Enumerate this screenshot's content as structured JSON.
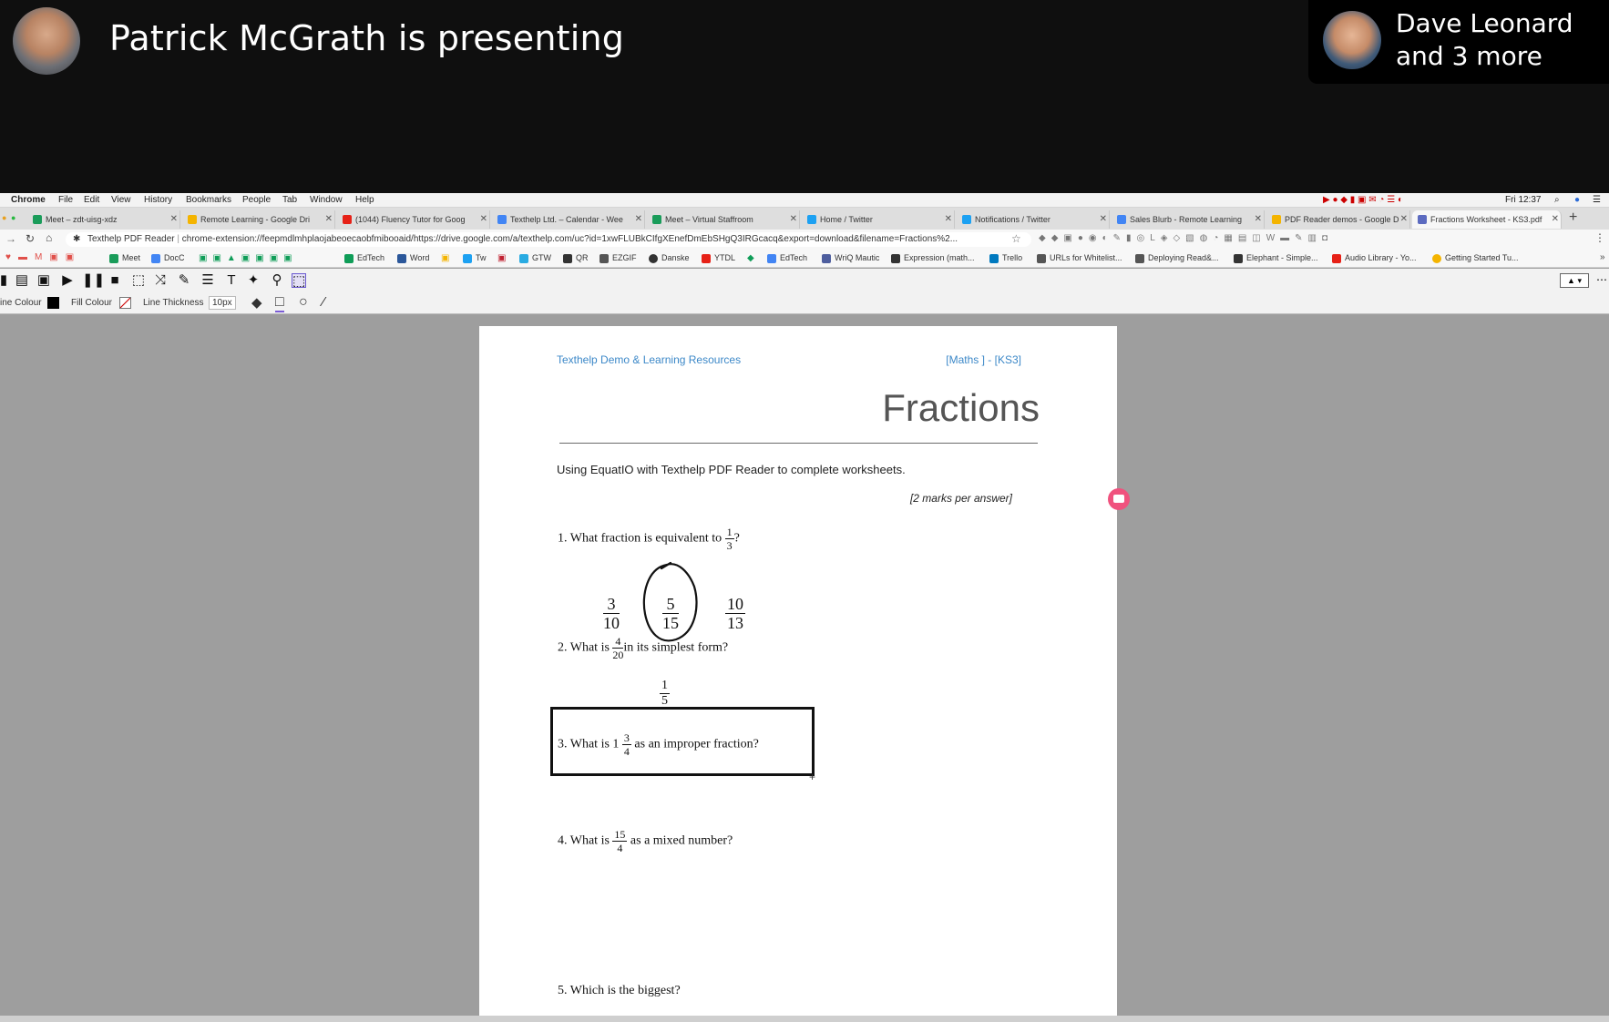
{
  "meet": {
    "presenter_text": "Patrick McGrath is presenting",
    "participants_line1": "Dave Leonard",
    "participants_line2": "and 3 more"
  },
  "mac_menu": {
    "items": [
      "Chrome",
      "File",
      "Edit",
      "View",
      "History",
      "Bookmarks",
      "People",
      "Tab",
      "Window",
      "Help"
    ],
    "clock": "Fri 12:37"
  },
  "tabs": [
    {
      "label": "Meet – zdt-uisg-xdz",
      "color": "#1a9c5a"
    },
    {
      "label": "Remote Learning - Google Dri",
      "color": "#f4b400"
    },
    {
      "label": "(1044) Fluency Tutor for Goog",
      "color": "#e62117"
    },
    {
      "label": "Texthelp Ltd. – Calendar - Wee",
      "color": "#4285f4"
    },
    {
      "label": "Meet – Virtual Staffroom",
      "color": "#1a9c5a"
    },
    {
      "label": "Home / Twitter",
      "color": "#1da1f2"
    },
    {
      "label": "Notifications / Twitter",
      "color": "#1da1f2"
    },
    {
      "label": "Sales Blurb - Remote Learning",
      "color": "#4285f4"
    },
    {
      "label": "PDF Reader demos - Google D",
      "color": "#f4b400"
    },
    {
      "label": "Fractions Worksheet - KS3.pdf",
      "color": "#5c6bc0"
    }
  ],
  "omnibox": {
    "site": "Texthelp PDF Reader",
    "url": "chrome-extension://feepmdlmhplaojabeoecaobfmibooaid/https://drive.google.com/a/texthelp.com/uc?id=1xwFLUBkCIfgXEnefDmEbSHgQ3IRGcacq&export=download&filename=Fractions%2..."
  },
  "bookmarks": [
    {
      "label": "Meet",
      "color": "#1a9c5a"
    },
    {
      "label": "DocC",
      "color": "#4285f4"
    },
    {
      "label": "EdTech",
      "color": "#0f9d58"
    },
    {
      "label": "Word",
      "color": "#2b579a"
    },
    {
      "label": "Tw",
      "color": "#1da1f2"
    },
    {
      "label": "GTW",
      "color": "#29abe2"
    },
    {
      "label": "QR",
      "color": "#333333"
    },
    {
      "label": "EZGIF",
      "color": "#555555"
    },
    {
      "label": "Danske",
      "color": "#333333"
    },
    {
      "label": "YTDL",
      "color": "#e62117"
    },
    {
      "label": "EdTech",
      "color": "#4285f4"
    },
    {
      "label": "WriQ Mautic",
      "color": "#4e5e9e"
    },
    {
      "label": "Expression (math...",
      "color": "#333333"
    },
    {
      "label": "Trello",
      "color": "#0079bf"
    },
    {
      "label": "URLs for Whitelist...",
      "color": "#555555"
    },
    {
      "label": "Deploying Read&...",
      "color": "#555555"
    },
    {
      "label": "Elephant - Simple...",
      "color": "#333333"
    },
    {
      "label": "Audio Library - Yo...",
      "color": "#e62117"
    },
    {
      "label": "Getting Started Tu...",
      "color": "#f4b400"
    }
  ],
  "drawing_toolbar": {
    "line_colour_label": "ine Colour",
    "fill_colour_label": "Fill Colour",
    "line_thickness_label": "Line Thickness",
    "line_thickness_value": "10px"
  },
  "worksheet": {
    "header_left": "Texthelp Demo & Learning Resources",
    "header_right": "[Maths ] - [KS3]",
    "title": "Fractions",
    "intro": "Using EquatIO with Texthelp PDF Reader to complete worksheets.",
    "marks": "[2 marks per answer]",
    "q1": {
      "prefix": "1. What fraction is equivalent to",
      "frac_n": "1",
      "frac_d": "3",
      "suffix": "?",
      "options": [
        {
          "n": "3",
          "d": "10"
        },
        {
          "n": "5",
          "d": "15"
        },
        {
          "n": "10",
          "d": "13"
        }
      ]
    },
    "q2": {
      "prefix": "2. What is",
      "frac_n": "4",
      "frac_d": "20",
      "suffix": "in its simplest form?",
      "answer_n": "1",
      "answer_d": "5"
    },
    "q3": {
      "prefix": "3. What is 1",
      "frac_n": "3",
      "frac_d": "4",
      "suffix": "as an improper fraction?"
    },
    "q4": {
      "prefix": "4. What is",
      "frac_n": "15",
      "frac_d": "4",
      "suffix": "as a mixed number?"
    },
    "q5": {
      "text": "5. Which is the biggest?"
    }
  },
  "colors": {
    "accent_link": "#3c88c8",
    "comment_bubble": "#f0527e"
  }
}
